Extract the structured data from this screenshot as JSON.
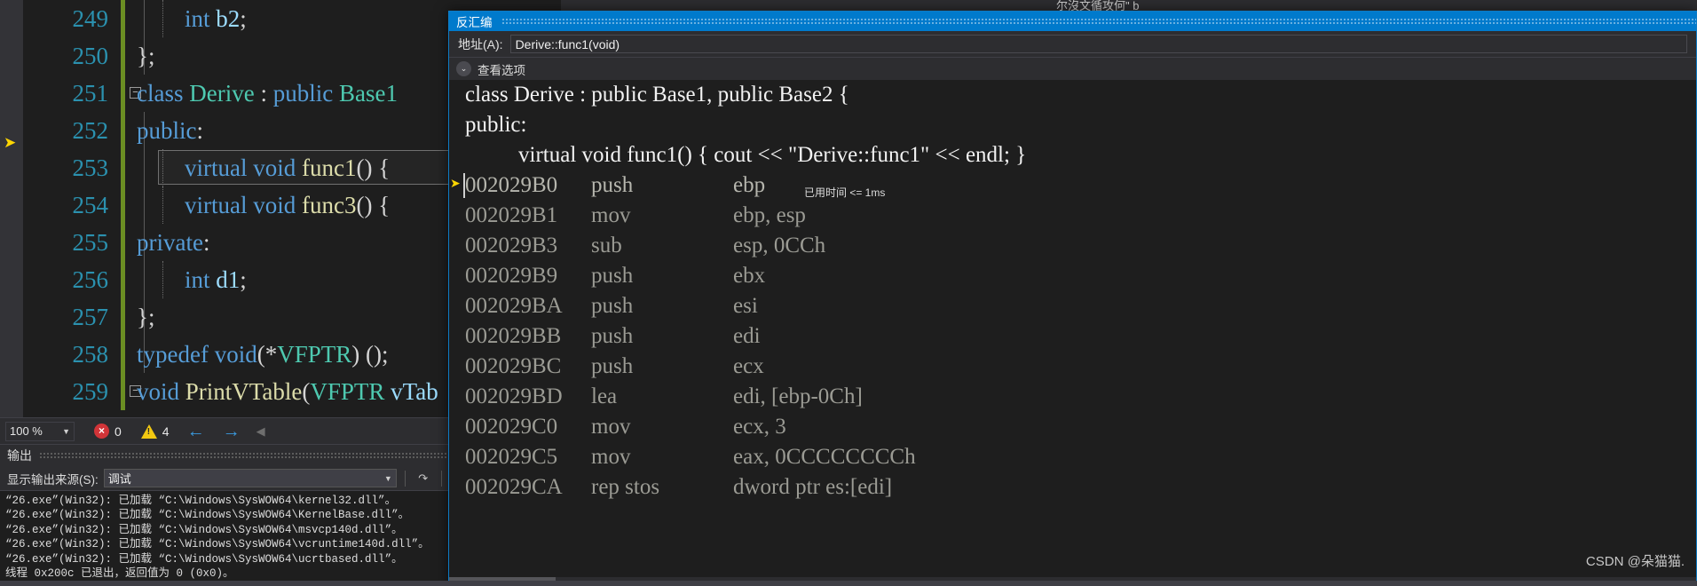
{
  "background": {
    "top_partial_text": "尔沒文循攻何\" b"
  },
  "editor": {
    "lines": [
      {
        "num": "249",
        "text": "        int b2;",
        "dotbar": true
      },
      {
        "num": "250",
        "text": "};",
        "endbrace": true
      },
      {
        "num": "251",
        "text": "class Derive : public Base1",
        "collapse": true
      },
      {
        "num": "252",
        "text": "public:"
      },
      {
        "num": "253",
        "text": "        virtual void func1() {",
        "highlight": true,
        "dotbar": true
      },
      {
        "num": "254",
        "text": "        virtual void func3() {",
        "dotbar": true
      },
      {
        "num": "255",
        "text": "private:"
      },
      {
        "num": "256",
        "text": "        int d1;",
        "dotbar": true
      },
      {
        "num": "257",
        "text": "};",
        "endbrace": true
      },
      {
        "num": "258",
        "text": "typedef void(*VFPTR) ();"
      },
      {
        "num": "259",
        "text": "void PrintVTable(VFPTR vTab",
        "collapse": true
      }
    ]
  },
  "statusbar": {
    "zoom_value": "100 %",
    "error_count": "0",
    "warning_count": "4",
    "error_glyph": "×",
    "back_arrow": "←",
    "forward_arrow": "→",
    "collapse_arrow": "◀"
  },
  "output": {
    "tab_label": "输出",
    "source_label": "显示输出来源(S):",
    "source_value": "调试",
    "caret": "▾",
    "toolbar_icons": [
      "clear-output-icon",
      "wrap-lines-icon",
      "toggle-word-wrap-icon"
    ],
    "lines": [
      "“26.exe”(Win32): 已加载 “C:\\Windows\\SysWOW64\\kernel32.dll”。",
      "“26.exe”(Win32): 已加载 “C:\\Windows\\SysWOW64\\KernelBase.dll”。",
      "“26.exe”(Win32): 已加载 “C:\\Windows\\SysWOW64\\msvcp140d.dll”。",
      "“26.exe”(Win32): 已加载 “C:\\Windows\\SysWOW64\\vcruntime140d.dll”。",
      "“26.exe”(Win32): 已加载 “C:\\Windows\\SysWOW64\\ucrtbased.dll”。",
      "线程 0x200c 已退出，返回值为 0 (0x0)。"
    ]
  },
  "disassembly": {
    "title": "反汇编",
    "address_label": "地址(A):",
    "address_value": "Derive::func1(void)",
    "view_options_label": "查看选项",
    "chevron": "⌄",
    "source_lines": [
      {
        "text": "class Derive : public Base1, public Base2 {",
        "indent": false
      },
      {
        "text": "public:",
        "indent": false
      },
      {
        "text": "virtual void func1() { cout << \"Derive::func1\" << endl; }",
        "indent": true
      }
    ],
    "elapsed_time": "已用时间 <= 1ms",
    "current_arrow": "➤",
    "instructions": [
      {
        "address": "002029B0",
        "mnemonic": "push",
        "operands": "ebp",
        "current": true
      },
      {
        "address": "002029B1",
        "mnemonic": "mov",
        "operands": "ebp, esp",
        "current": false
      },
      {
        "address": "002029B3",
        "mnemonic": "sub",
        "operands": "esp, 0CCh",
        "current": false
      },
      {
        "address": "002029B9",
        "mnemonic": "push",
        "operands": "ebx",
        "current": false
      },
      {
        "address": "002029BA",
        "mnemonic": "push",
        "operands": "esi",
        "current": false
      },
      {
        "address": "002029BB",
        "mnemonic": "push",
        "operands": "edi",
        "current": false
      },
      {
        "address": "002029BC",
        "mnemonic": "push",
        "operands": "ecx",
        "current": false
      },
      {
        "address": "002029BD",
        "mnemonic": "lea",
        "operands": "edi, [ebp-0Ch]",
        "current": false
      },
      {
        "address": "002029C0",
        "mnemonic": "mov",
        "operands": "ecx, 3",
        "current": false
      },
      {
        "address": "002029C5",
        "mnemonic": "mov",
        "operands": "eax, 0CCCCCCCCh",
        "current": false
      },
      {
        "address": "002029CA",
        "mnemonic": "rep stos",
        "operands": "dword ptr es:[edi]",
        "current": false
      }
    ]
  },
  "watermark": "CSDN @朵猫猫.",
  "colors": {
    "accent_blue": "#007acc",
    "editor_bg": "#1e1e1e",
    "panel_bg": "#2d2d30",
    "line_number": "#2b91af",
    "keyword": "#569cd6",
    "type": "#4ec9b0",
    "function": "#dcdcaa",
    "error_red": "#d13438",
    "warning_yellow": "#f2c811",
    "change_bar_green": "#6b8e23",
    "current_line_yellow": "#ffd602"
  }
}
